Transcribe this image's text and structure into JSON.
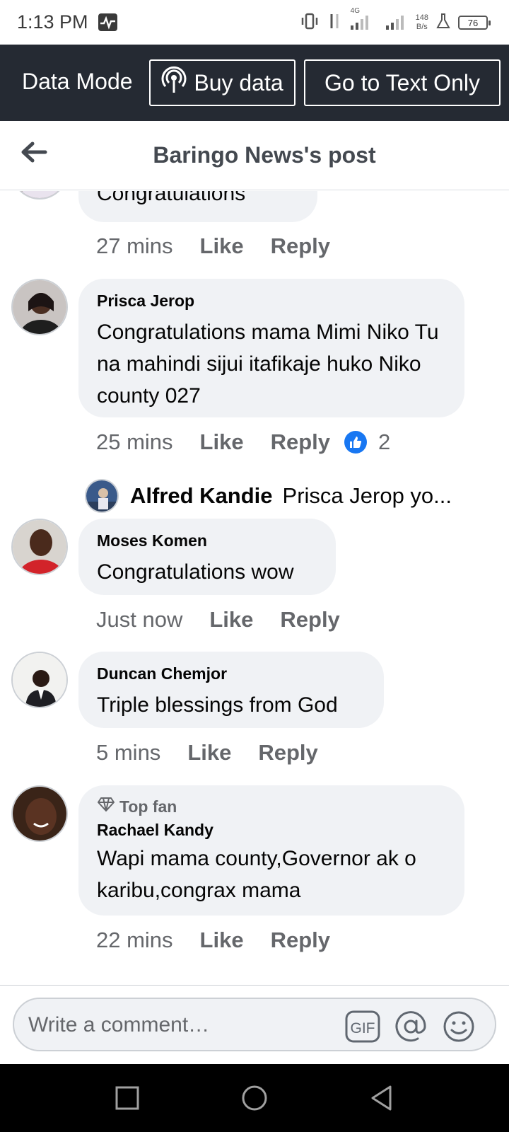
{
  "status_bar": {
    "time": "1:13 PM",
    "network": "4G",
    "speed_value": "148",
    "speed_unit": "B/s",
    "battery": "76"
  },
  "data_bar": {
    "mode_label": "Data Mode",
    "buy_label": "Buy data",
    "text_only_label": "Go to Text Only"
  },
  "header": {
    "title": "Baringo News's post"
  },
  "actions": {
    "like": "Like",
    "reply": "Reply"
  },
  "comments": [
    {
      "name": "",
      "text": "Congratulations",
      "time": "27 mins"
    },
    {
      "name": "Prisca Jerop",
      "text": "Congratulations mama Mimi Niko Tu na mahindi sijui itafikaje huko Niko county 027",
      "time": "25 mins",
      "reactions": "2"
    },
    {
      "name": "Moses Komen",
      "text": "Congratulations wow",
      "time": "Just now"
    },
    {
      "name": "Duncan Chemjor",
      "text": "Triple blessings from God",
      "time": "5 mins"
    },
    {
      "name": "Rachael Kandy",
      "badge": "Top fan",
      "text": "Wapi mama county,Governor ak o karibu,congrax mama",
      "time": "22 mins"
    }
  ],
  "reply_preview": {
    "name": "Alfred Kandie",
    "text": "Prisca Jerop yo..."
  },
  "composer": {
    "placeholder": "Write a comment…"
  },
  "colors": {
    "brand": "#1877f2",
    "data_bar": "#252a33",
    "bubble": "#f0f2f5",
    "meta": "#65676b"
  }
}
